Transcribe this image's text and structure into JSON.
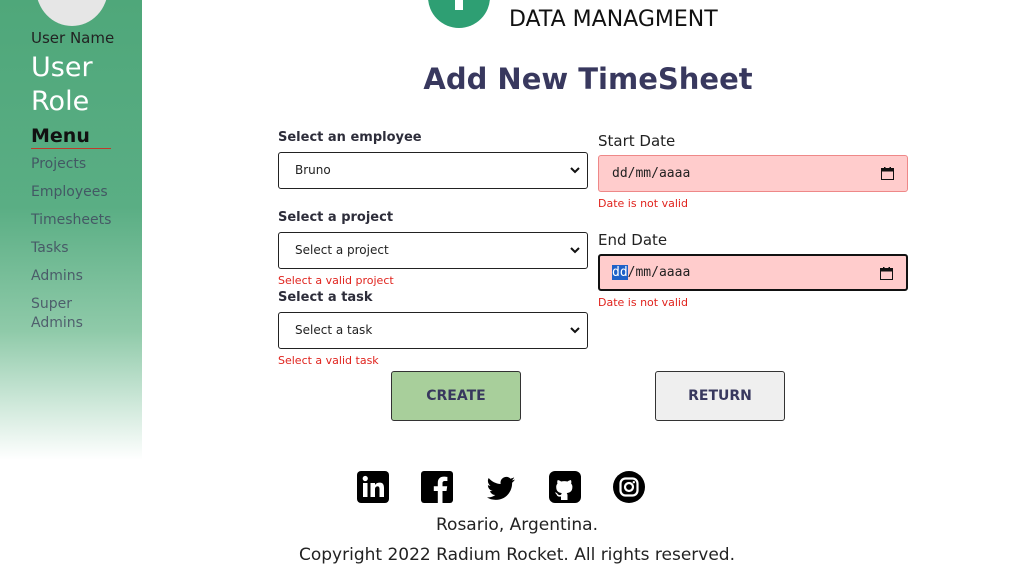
{
  "sidebar": {
    "user_name": "User Name",
    "user_role": "User Role",
    "menu_title": "Menu",
    "items": [
      {
        "label": "Projects"
      },
      {
        "label": "Employees"
      },
      {
        "label": "Timesheets"
      },
      {
        "label": "Tasks"
      },
      {
        "label": "Admins"
      },
      {
        "label": "Super Admins"
      }
    ]
  },
  "header": {
    "brand_sub": "DATA MANAGMENT",
    "page_title": "Add New TimeSheet"
  },
  "form": {
    "employee": {
      "label": "Select an employee",
      "value": "Bruno"
    },
    "project": {
      "label": "Select a project",
      "value": "Select a project",
      "error": "Select a valid project"
    },
    "task": {
      "label": "Select a task",
      "value": "Select a task",
      "error": "Select a valid task"
    },
    "start_date": {
      "label": "Start Date",
      "placeholder_rest": "/mm/aaaa",
      "placeholder_day": "dd",
      "error": "Date is not valid"
    },
    "end_date": {
      "label": "End Date",
      "placeholder_rest": "/mm/aaaa",
      "placeholder_day": "dd",
      "error": "Date is not valid"
    },
    "create_label": "CREATE",
    "return_label": "RETURN"
  },
  "footer": {
    "location": "Rosario, Argentina.",
    "copyright": "Copyright 2022 Radium Rocket. All rights reserved."
  },
  "colors": {
    "sidebar": "#4fa77a",
    "title": "#38385e",
    "error": "#e0231d",
    "invalid_field": "#ffcccc",
    "create_button": "#a8cf9b"
  }
}
